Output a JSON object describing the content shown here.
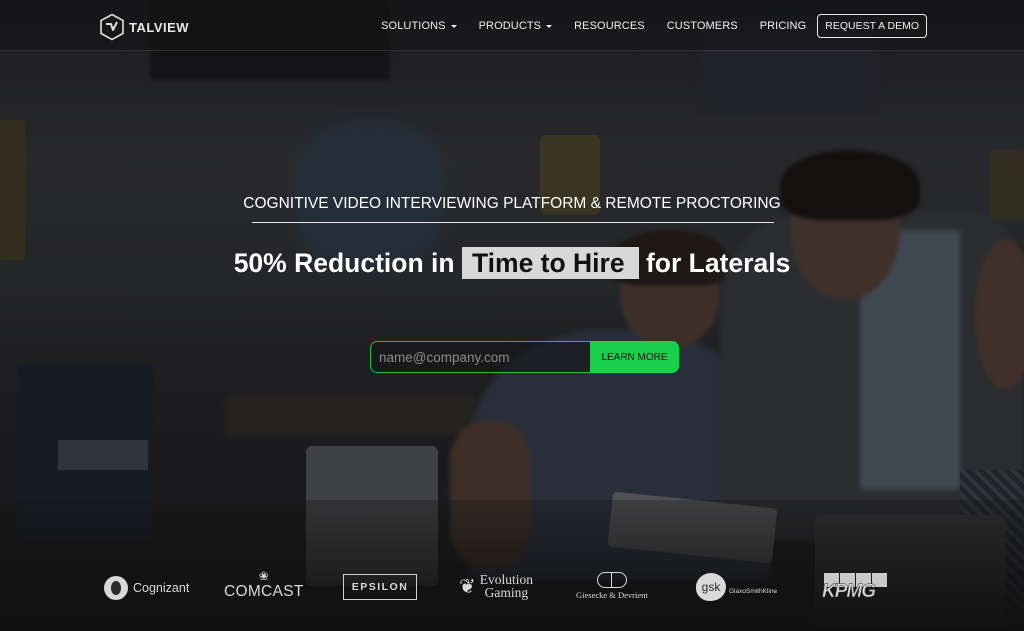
{
  "header": {
    "logo_text": "TALVIEW",
    "nav": [
      {
        "label": "SOLUTIONS",
        "has_dropdown": true
      },
      {
        "label": "PRODUCTS",
        "has_dropdown": true
      },
      {
        "label": "RESOURCES",
        "has_dropdown": false
      },
      {
        "label": "CUSTOMERS",
        "has_dropdown": false
      },
      {
        "label": "PRICING",
        "has_dropdown": false
      }
    ],
    "cta_label": "REQUEST A DEMO"
  },
  "hero": {
    "eyebrow": "COGNITIVE VIDEO INTERVIEWING PLATFORM & REMOTE PROCTORING",
    "headline_prefix": "50% Reduction in",
    "headline_highlight": "Time to Hire",
    "headline_suffix": "for Laterals",
    "email_placeholder": "name@company.com",
    "email_value": "",
    "submit_label": "LEARN MORE"
  },
  "clients": {
    "cognizant": "Cognizant",
    "comcast": "COMCAST",
    "epsilon": "EPSILON",
    "evolution": "Evolution\nGaming",
    "gd": "Giesecke & Devrient",
    "gsk_mark": "gsk",
    "gsk_name": "GlaxoSmithKline",
    "kpmg": "KPMG"
  },
  "colors": {
    "accent_green": "#19d04d",
    "highlight_bg": "#d8d8d8"
  }
}
